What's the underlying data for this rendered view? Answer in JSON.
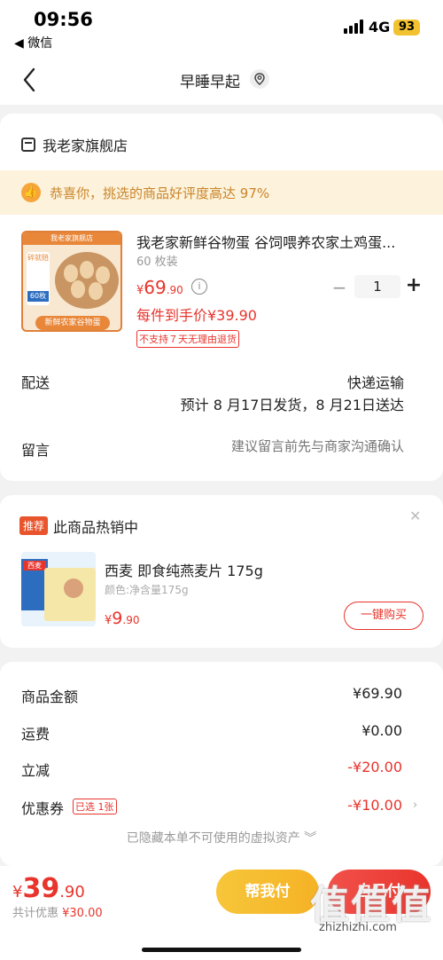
{
  "status_bar": {
    "time": "09:56",
    "back_app": "◀ 微信",
    "network": "4G",
    "battery": "93"
  },
  "nav": {
    "title": "早睡早起",
    "back_icon": "chevron-left-icon",
    "pin_icon": "location-pin-icon"
  },
  "store": {
    "name": "我老家旗舰店",
    "icon": "store-icon"
  },
  "praise": {
    "text": "恭喜你，挑选的商品好评度高达 97%",
    "icon": "thumb-up-icon",
    "color": "#c9842a"
  },
  "product": {
    "image_top_text": "我老家旗舰店",
    "image_bottom_text": "新鲜农家谷物蛋",
    "image_count_badge": "60枚",
    "image_side_badge": "碎就赔",
    "title": "我老家新鲜谷物蛋 谷饲喂养农家土鸡蛋...",
    "spec": "60 枚装",
    "price_yen": "¥",
    "price_int": "69",
    "price_dec": ".90",
    "unit_price": "每件到手价¥39.90",
    "no_return_tag": "不支持７天无理由退货",
    "quantity": "1",
    "minus": "−",
    "plus": "+",
    "info_icon": "i"
  },
  "shipping": {
    "label": "配送",
    "method": "快递运输",
    "date": "预计 8 月17日发货，8 月21日送达"
  },
  "note": {
    "label": "留言",
    "placeholder": "建议留言前先与商家沟通确认"
  },
  "recommend": {
    "tag": "推荐",
    "title": "此商品热销中",
    "close": "✕",
    "image_brand": "西麦",
    "name": "西麦 即食纯燕麦片 175g",
    "spec": "颜色:净含量175g",
    "price_yen": "¥",
    "price_int": "9",
    "price_dec": ".90",
    "buy_button": "一键购买"
  },
  "summary": {
    "goods_label": "商品金额",
    "goods_value": "¥69.90",
    "freight_label": "运费",
    "freight_value": "¥0.00",
    "discount_label": "立减",
    "discount_value": "-¥20.00",
    "coupon_label": "优惠券",
    "coupon_tag": "已选 1张",
    "coupon_value": "-¥10.00",
    "coupon_arrow": "›",
    "hidden_assets": "已隐藏本单不可使用的虚拟资产 ︾"
  },
  "bottom": {
    "total_yen": "¥",
    "total_int": "39",
    "total_dec": ".90",
    "discount_prefix": "共计优惠 ",
    "discount_value": "¥30.00",
    "help_pay": "帮我付",
    "self_pay": "自己付",
    "watermark": "值值值",
    "watermark_url": "zhizhizhi.com"
  },
  "colors": {
    "accent_red": "#e8342c",
    "yellow": "#f5b225",
    "praise_bg": "#fdf3dc"
  }
}
